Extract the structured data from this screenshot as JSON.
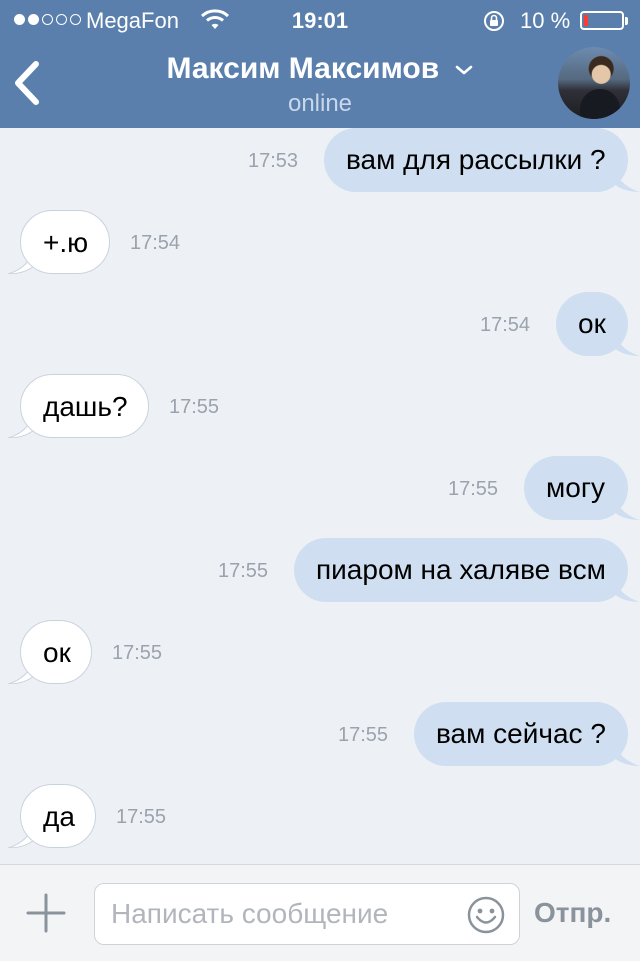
{
  "status_bar": {
    "carrier": "MegaFon",
    "time": "19:01",
    "battery_percent": "10 %",
    "battery_level": 0.1,
    "signal_bars_filled": 2,
    "signal_bars_total": 5
  },
  "header": {
    "contact_name": "Максим Максимов",
    "status": "online"
  },
  "messages": [
    {
      "direction": "outgoing",
      "text": "вам для рассылки ?",
      "time": "17:53"
    },
    {
      "direction": "incoming",
      "text": "+.ю",
      "time": "17:54"
    },
    {
      "direction": "outgoing",
      "text": "ок",
      "time": "17:54"
    },
    {
      "direction": "incoming",
      "text": "дашь?",
      "time": "17:55"
    },
    {
      "direction": "outgoing",
      "text": "могу",
      "time": "17:55"
    },
    {
      "direction": "outgoing",
      "text": "пиаром на халяве всм",
      "time": "17:55"
    },
    {
      "direction": "incoming",
      "text": "ок",
      "time": "17:55"
    },
    {
      "direction": "outgoing",
      "text": "вам сейчас ?",
      "time": "17:55"
    },
    {
      "direction": "incoming",
      "text": "да",
      "time": "17:55"
    }
  ],
  "composer": {
    "placeholder": "Написать сообщение",
    "send_label": "Отпр."
  },
  "colors": {
    "header_bg": "#5a7fad",
    "chat_bg": "#edf1f5",
    "outgoing_bubble": "#cfdff1",
    "incoming_bubble": "#ffffff",
    "battery_low": "#ff3b30"
  }
}
